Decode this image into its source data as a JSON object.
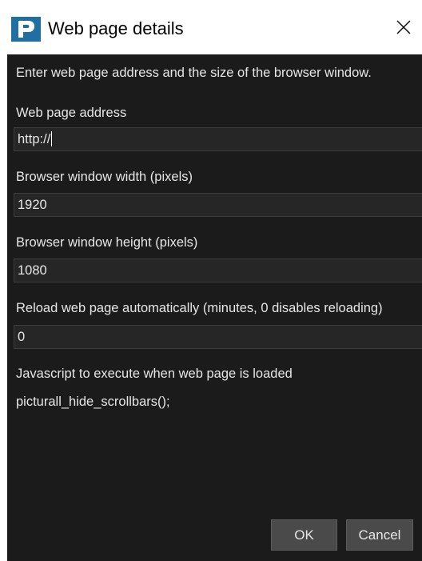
{
  "window": {
    "title": "Web page details",
    "icon": "picturall-p-icon",
    "close_icon": "close-icon",
    "accent_color": "#1f6fa3"
  },
  "dialog": {
    "intro": "Enter web page address and the size of the browser window.",
    "address": {
      "label": "Web page address",
      "value": "http://"
    },
    "width": {
      "label": "Browser window width (pixels)",
      "value": "1920"
    },
    "height": {
      "label": "Browser window height (pixels)",
      "value": "1080"
    },
    "reload": {
      "label": "Reload web page automatically (minutes, 0 disables reloading)",
      "value": "0"
    },
    "script": {
      "label": "Javascript to execute when web page is loaded",
      "value": "picturall_hide_scrollbars();"
    }
  },
  "buttons": {
    "ok_label": "OK",
    "cancel_label": "Cancel"
  }
}
